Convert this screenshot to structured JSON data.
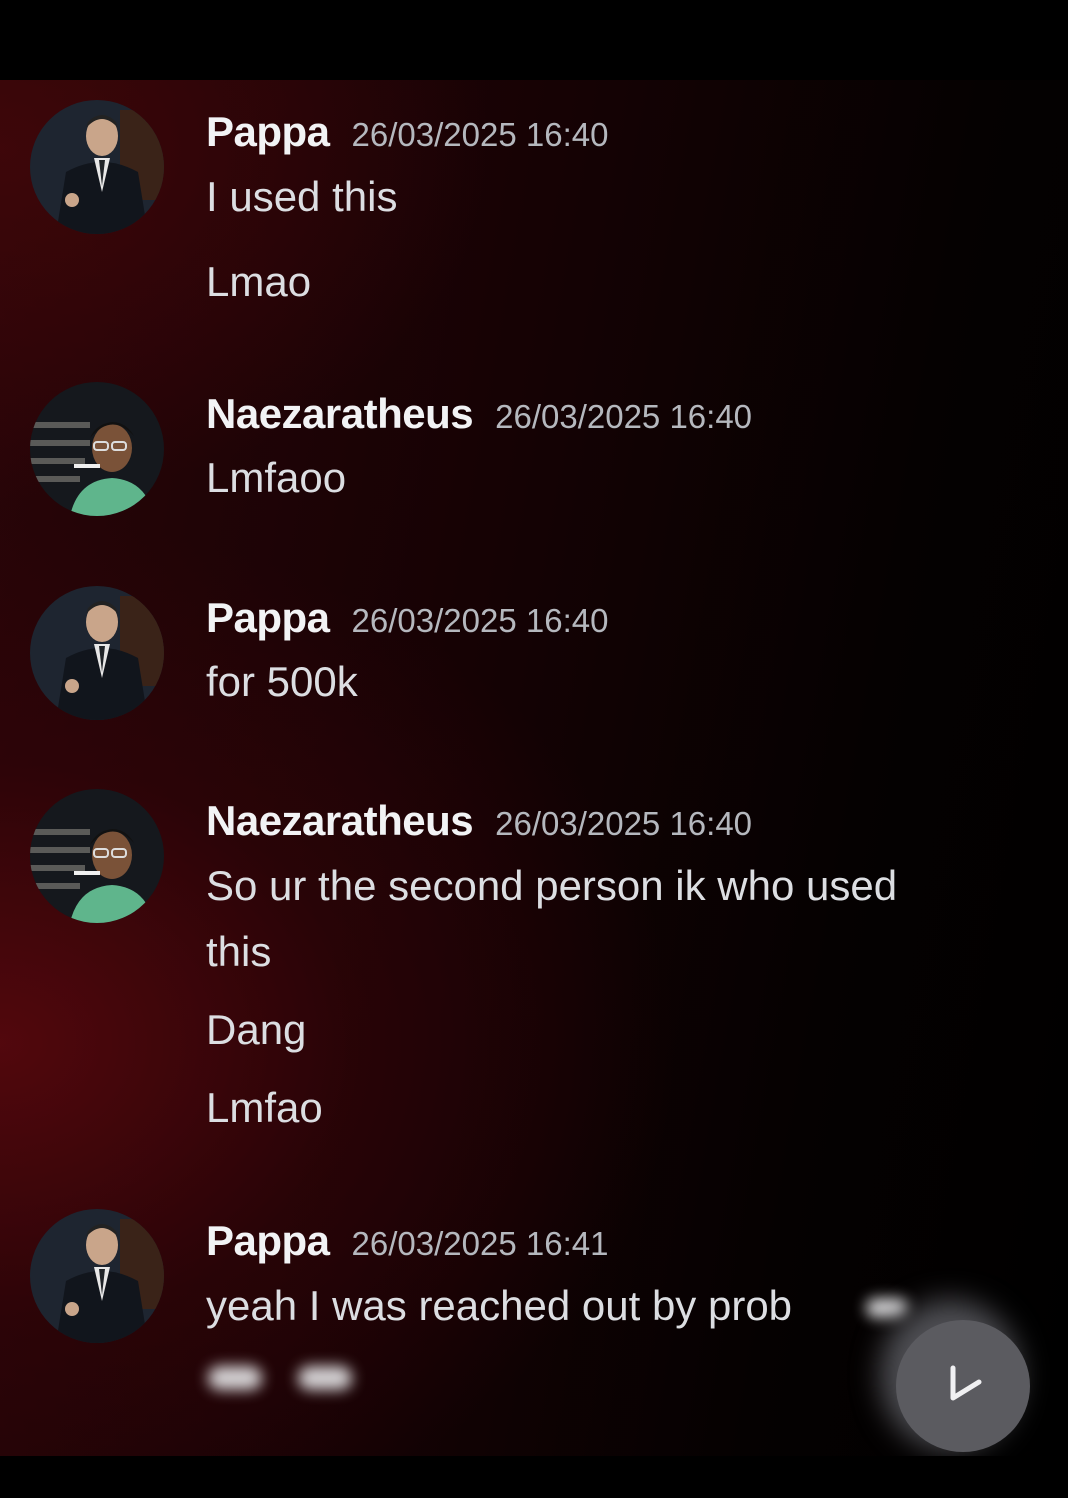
{
  "messages": [
    {
      "author": "Pappa",
      "timestamp": "26/03/2025 16:40",
      "lines": [
        "I used this",
        "Lmao"
      ]
    },
    {
      "author": "Naezaratheus",
      "timestamp": "26/03/2025 16:40",
      "lines": [
        "Lmfaoo"
      ]
    },
    {
      "author": "Pappa",
      "timestamp": "26/03/2025 16:40",
      "lines": [
        "for 500k"
      ]
    },
    {
      "author": "Naezaratheus",
      "timestamp": "26/03/2025 16:40",
      "lines": [
        "So ur the second person ik who used",
        "this",
        "Dang",
        "Lmfao"
      ]
    },
    {
      "author": "Pappa",
      "timestamp": "26/03/2025 16:41",
      "lines": [
        "yeah I was reached out by prob"
      ]
    }
  ],
  "icons": {
    "scroll": "arrow-down-icon",
    "avatar_pappa": "user-avatar",
    "avatar_naez": "user-avatar"
  },
  "colors": {
    "username": "#f2f3f5",
    "timestamp": "#b5b8be",
    "message": "#dcdee2",
    "accent_bg": "#2a0508"
  }
}
